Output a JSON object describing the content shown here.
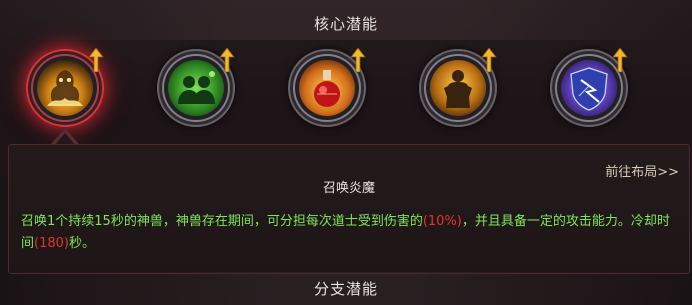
{
  "header": {
    "title": "核心潜能"
  },
  "skills": [
    {
      "icon": "fire-demon-icon",
      "selected": true
    },
    {
      "icon": "twin-summon-icon",
      "selected": false
    },
    {
      "icon": "poison-flask-icon",
      "selected": false
    },
    {
      "icon": "golden-warrior-icon",
      "selected": false
    },
    {
      "icon": "crystal-shield-icon",
      "selected": false
    }
  ],
  "info": {
    "goto_label": "前往布局>>",
    "skill_name": "召唤炎魔",
    "desc_part1": "召唤1个持续15秒的神兽，神兽存在期间，可分担每次道士受到伤害的",
    "desc_val1": "(10%)",
    "desc_part2": "，并且具备一定的攻击能力。冷却时间",
    "desc_val2": "(180)",
    "desc_part3": "秒。"
  },
  "branch": {
    "title": "分支潜能"
  },
  "colors": {
    "desc_text": "#7fe55a",
    "highlight": "#e0362d",
    "selected_glow": "#d83436"
  }
}
